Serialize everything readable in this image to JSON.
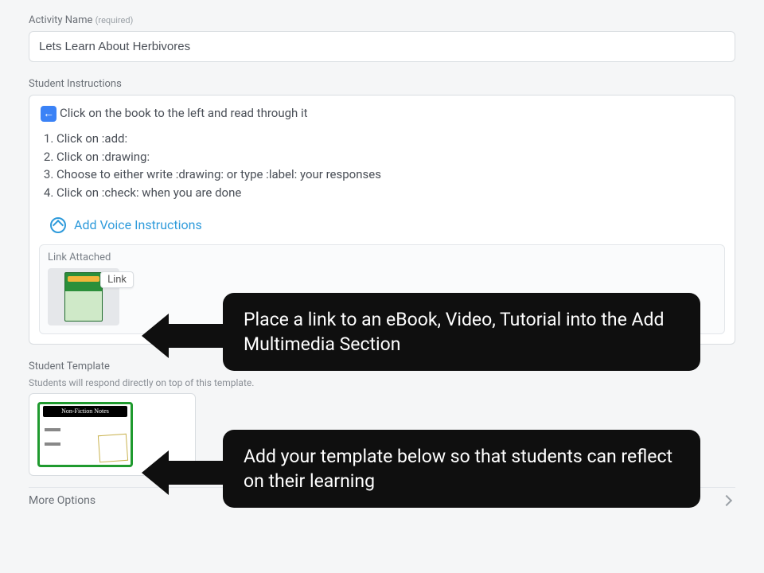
{
  "activity_name": {
    "label": "Activity Name",
    "required_hint": "(required)",
    "value": "Lets Learn About Herbivores"
  },
  "instructions": {
    "label": "Student Instructions",
    "lead": "Click on the book to the left and read through it",
    "steps": [
      "Click on :add:",
      "Click on :drawing:",
      "Choose to either write :drawing: or type :label: your responses",
      "Click on :check: when you are done"
    ],
    "voice_link": "Add Voice Instructions"
  },
  "attachment": {
    "label": "Link Attached",
    "badge": "Link"
  },
  "template": {
    "label": "Student Template",
    "subtext": "Students will respond directly on top of this template.",
    "thumb_title": "Non-Fiction Notes"
  },
  "more_options": "More Options",
  "annotations": {
    "a1": "Place a link to an eBook, Video, Tutorial into the Add Multimedia Section",
    "a2": "Add your template below so that students can reflect on their learning"
  }
}
